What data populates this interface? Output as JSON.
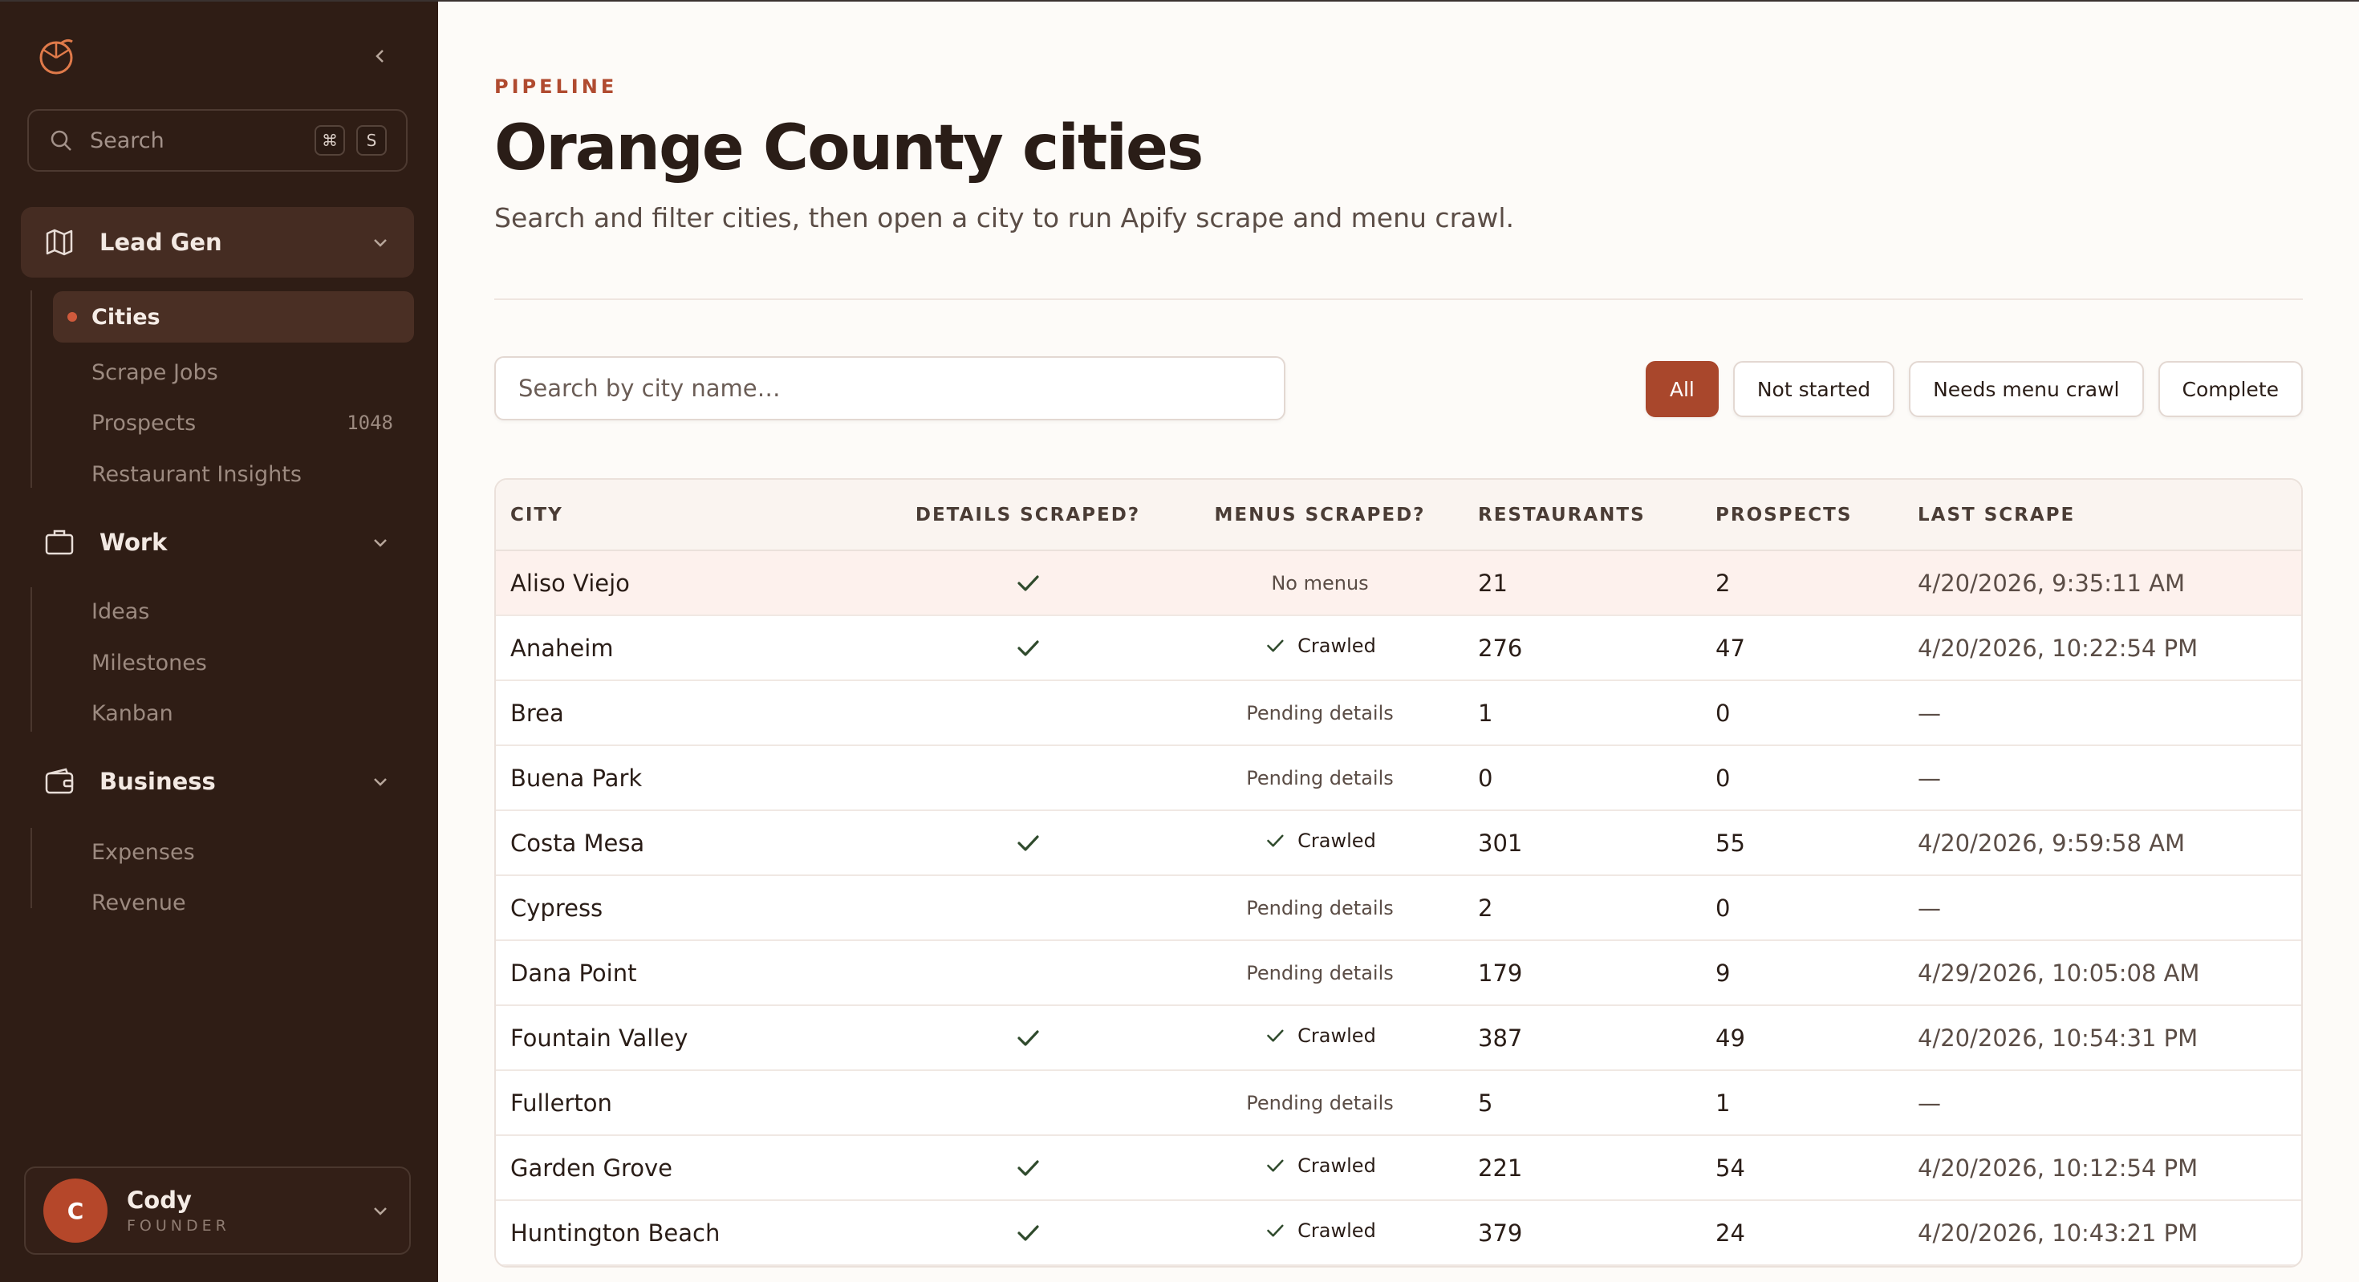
{
  "sidebar": {
    "search_label": "Search",
    "search_kbd": [
      "⌘",
      "S"
    ],
    "groups": [
      {
        "label": "Lead Gen",
        "items": [
          {
            "label": "Cities"
          },
          {
            "label": "Scrape Jobs"
          },
          {
            "label": "Prospects",
            "count": "1048"
          },
          {
            "label": "Restaurant Insights"
          }
        ]
      },
      {
        "label": "Work",
        "items": [
          {
            "label": "Ideas"
          },
          {
            "label": "Milestones"
          },
          {
            "label": "Kanban"
          }
        ]
      },
      {
        "label": "Business",
        "items": [
          {
            "label": "Expenses"
          },
          {
            "label": "Revenue"
          }
        ]
      }
    ],
    "user": {
      "initial": "C",
      "name": "Cody",
      "role": "FOUNDER"
    }
  },
  "main": {
    "eyebrow": "PIPELINE",
    "title": "Orange County cities",
    "subtitle": "Search and filter cities, then open a city to run Apify scrape and menu crawl.",
    "search_placeholder": "Search by city name…",
    "filters": [
      "All",
      "Not started",
      "Needs menu crawl",
      "Complete"
    ],
    "active_filter": "All",
    "accent_color": "#a9472c",
    "table": {
      "headers": [
        "CITY",
        "DETAILS SCRAPED?",
        "MENUS SCRAPED?",
        "RESTAURANTS",
        "PROSPECTS",
        "LAST SCRAPE"
      ],
      "rows": [
        {
          "city": "Aliso Viejo",
          "details": true,
          "menus": "No menus",
          "restaurants": "21",
          "prospects": "2",
          "last": "4/20/2026, 9:35:11 AM"
        },
        {
          "city": "Anaheim",
          "details": true,
          "menus": "Crawled",
          "restaurants": "276",
          "prospects": "47",
          "last": "4/20/2026, 10:22:54 PM"
        },
        {
          "city": "Brea",
          "details": false,
          "menus": "Pending details",
          "restaurants": "1",
          "prospects": "0",
          "last": "—"
        },
        {
          "city": "Buena Park",
          "details": false,
          "menus": "Pending details",
          "restaurants": "0",
          "prospects": "0",
          "last": "—"
        },
        {
          "city": "Costa Mesa",
          "details": true,
          "menus": "Crawled",
          "restaurants": "301",
          "prospects": "55",
          "last": "4/20/2026, 9:59:58 AM"
        },
        {
          "city": "Cypress",
          "details": false,
          "menus": "Pending details",
          "restaurants": "2",
          "prospects": "0",
          "last": "—"
        },
        {
          "city": "Dana Point",
          "details": false,
          "menus": "Pending details",
          "restaurants": "179",
          "prospects": "9",
          "last": "4/29/2026, 10:05:08 AM"
        },
        {
          "city": "Fountain Valley",
          "details": true,
          "menus": "Crawled",
          "restaurants": "387",
          "prospects": "49",
          "last": "4/20/2026, 10:54:31 PM"
        },
        {
          "city": "Fullerton",
          "details": false,
          "menus": "Pending details",
          "restaurants": "5",
          "prospects": "1",
          "last": "—"
        },
        {
          "city": "Garden Grove",
          "details": true,
          "menus": "Crawled",
          "restaurants": "221",
          "prospects": "54",
          "last": "4/20/2026, 10:12:54 PM"
        },
        {
          "city": "Huntington Beach",
          "details": true,
          "menus": "Crawled",
          "restaurants": "379",
          "prospects": "24",
          "last": "4/20/2026, 10:43:21 PM"
        }
      ]
    }
  }
}
